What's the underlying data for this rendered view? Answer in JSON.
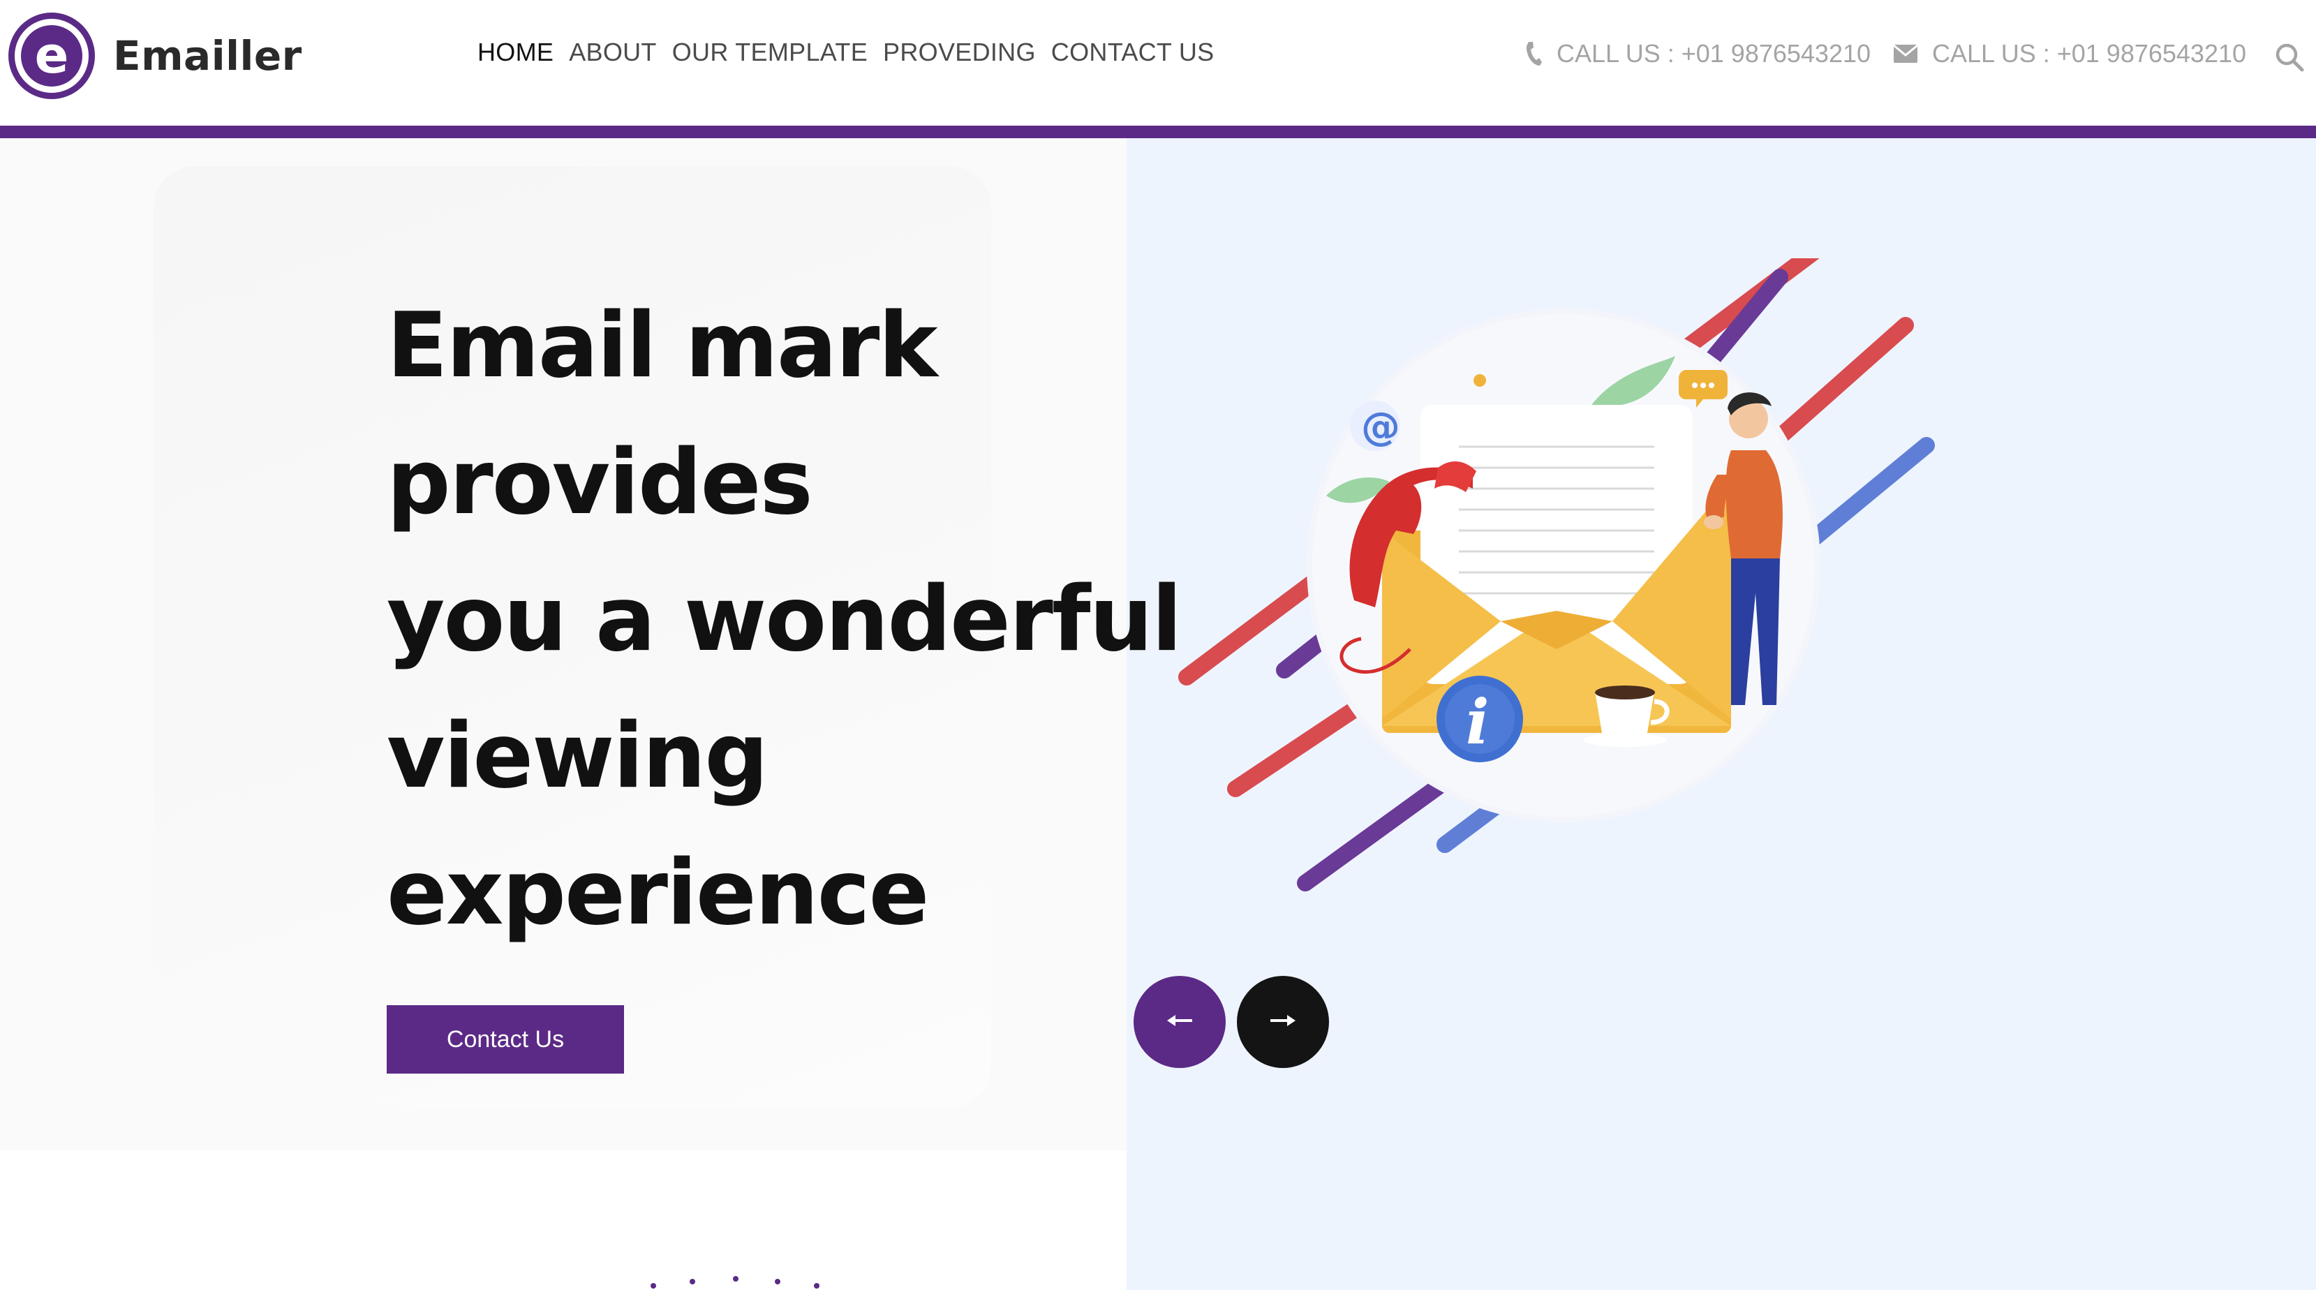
{
  "brand": {
    "logo_letter": "e",
    "name": "Emailler",
    "primary_color": "#5b2a86",
    "dark_color": "#141414"
  },
  "nav": {
    "items": [
      {
        "label": "HOME",
        "active": true
      },
      {
        "label": "ABOUT",
        "active": false
      },
      {
        "label": "OUR TEMPLATE",
        "active": false
      },
      {
        "label": "PROVEDING",
        "active": false
      },
      {
        "label": "CONTACT US",
        "active": false
      }
    ]
  },
  "contacts": {
    "phone": {
      "icon": "phone-icon",
      "text": "CALL US : +01 9876543210"
    },
    "email": {
      "icon": "envelope-icon",
      "text": "CALL US : +01 9876543210"
    },
    "search_icon": "search-icon"
  },
  "hero": {
    "headline_lines": [
      "Email mark",
      "provides",
      "you a wonderful",
      "viewing",
      "experience"
    ],
    "cta_label": "Contact Us",
    "prev_icon": "arrow-left-icon",
    "next_icon": "arrow-right-icon",
    "illustration": "email-support-illustration"
  }
}
